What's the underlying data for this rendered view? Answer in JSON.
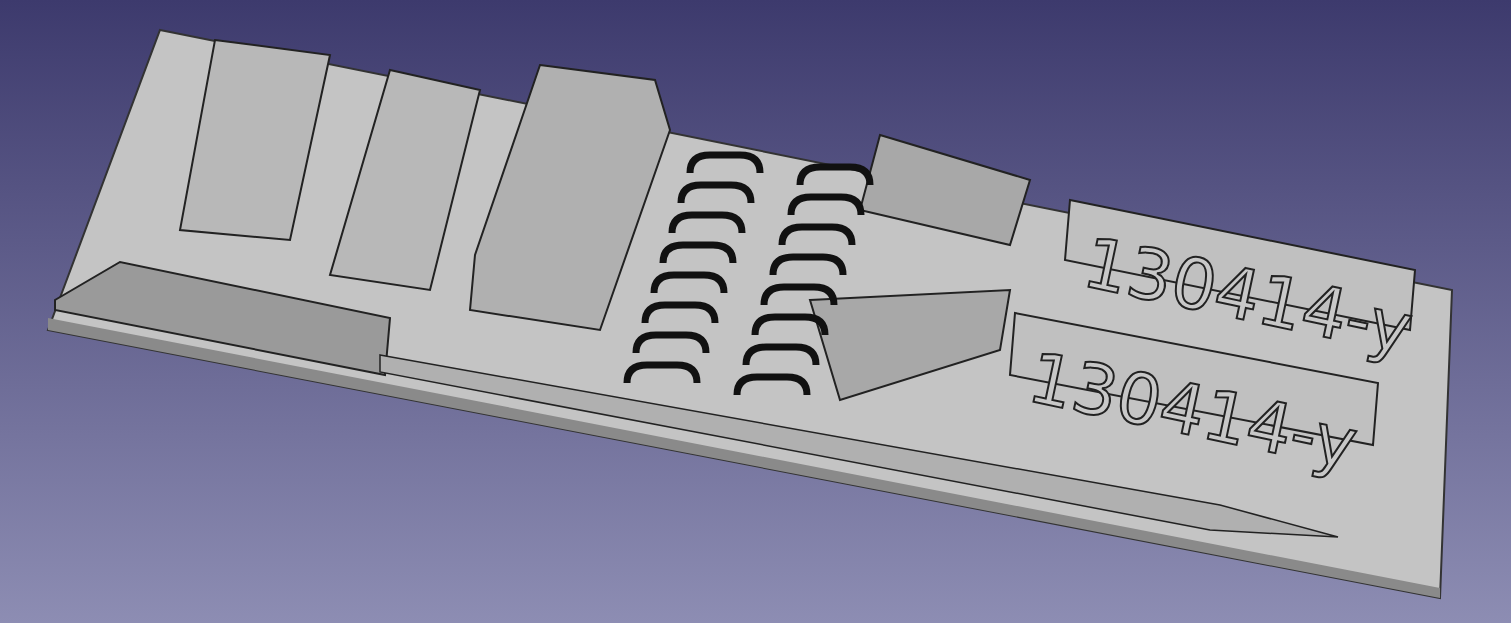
{
  "viewport": {
    "engraved_labels": [
      {
        "text": "130414-y"
      },
      {
        "text": "130414-y"
      }
    ]
  }
}
